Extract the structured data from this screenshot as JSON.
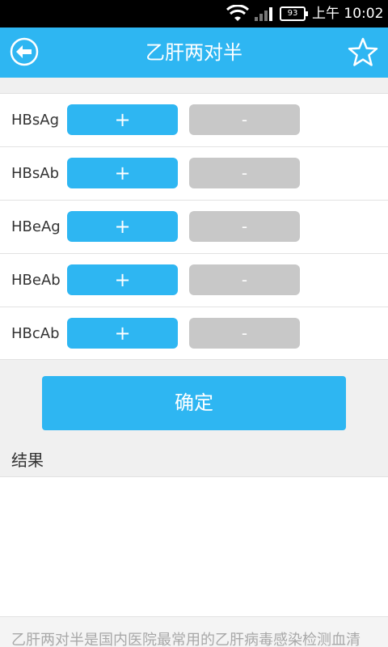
{
  "status_bar": {
    "battery": "93",
    "time": "上午 10:02"
  },
  "header": {
    "title": "乙肝两对半"
  },
  "markers": [
    {
      "name": "HBsAg",
      "positive": "+",
      "negative": "-"
    },
    {
      "name": "HBsAb",
      "positive": "+",
      "negative": "-"
    },
    {
      "name": "HBeAg",
      "positive": "+",
      "negative": "-"
    },
    {
      "name": "HBeAb",
      "positive": "+",
      "negative": "-"
    },
    {
      "name": "HBcAb",
      "positive": "+",
      "negative": "-"
    }
  ],
  "confirm_label": "确定",
  "result_label": "结果",
  "description": "乙肝两对半是国内医院最常用的乙肝病毒感染检测血清",
  "colors": {
    "accent": "#2eb6f2",
    "negative_button": "#c8c8c8",
    "background": "#f0f0f0"
  }
}
